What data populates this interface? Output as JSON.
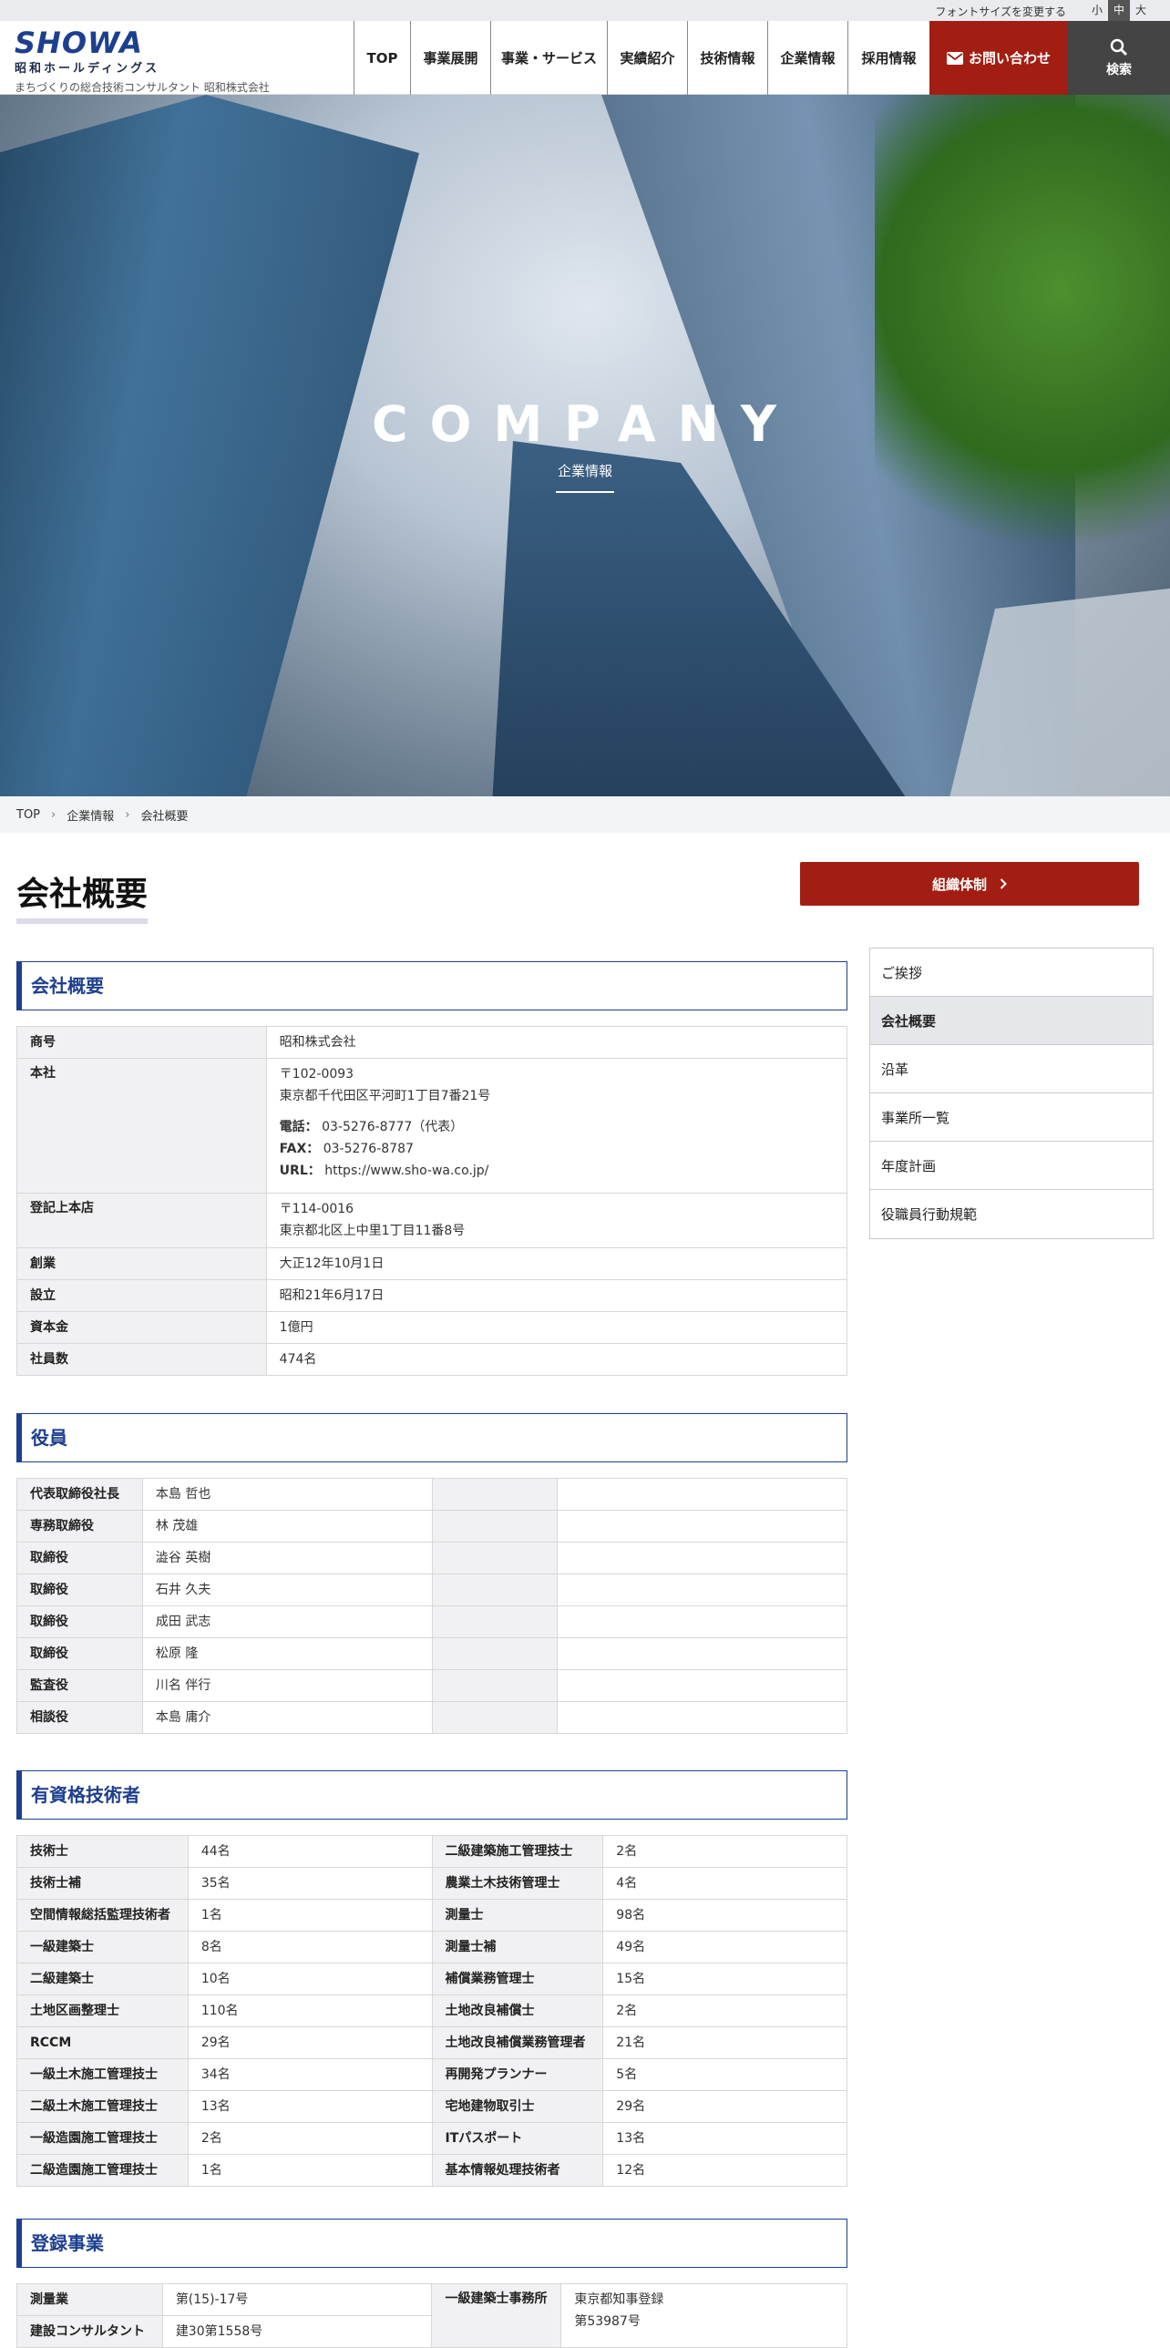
{
  "util": {
    "font_size_label": "フォントサイズを変更する",
    "sizes": [
      "小",
      "中",
      "大"
    ],
    "active": "中"
  },
  "header": {
    "logo_mark": "SHOWA",
    "logo_kana": "昭和ホールディングス",
    "tagline": "まちづくりの総合技術コンサルタント 昭和株式会社",
    "nav": [
      "TOP",
      "事業展開",
      "事業・サービス",
      "実績紹介",
      "技術情報",
      "企業情報",
      "採用情報"
    ],
    "contact": "お問い合わせ",
    "search": "検索"
  },
  "hero": {
    "title": "COMPANY",
    "subtitle": "企業情報"
  },
  "breadcrumb": [
    "TOP",
    "企業情報",
    "会社概要"
  ],
  "page_title": "会社概要",
  "org_button": "組織体制",
  "sections": {
    "overview": "会社概要",
    "officers": "役員",
    "engineers": "有資格技術者",
    "registration": "登録事業"
  },
  "overview": {
    "rows": [
      {
        "label": "商号",
        "value": "昭和株式会社"
      },
      {
        "label": "本社"
      },
      {
        "label": "登記上本店"
      },
      {
        "label": "創業",
        "value": "大正12年10月1日"
      },
      {
        "label": "設立",
        "value": "昭和21年6月17日"
      },
      {
        "label": "資本金",
        "value": "1億円"
      },
      {
        "label": "社員数",
        "value": "474名"
      }
    ],
    "hq": {
      "zip": "〒102-0093",
      "address": "東京都千代田区平河町1丁目7番21号",
      "tel_label": "電話：",
      "tel": "03-5276-8777（代表）",
      "fax_label": "FAX：",
      "fax": "03-5276-8787",
      "url_label": "URL：",
      "url": "https://www.sho-wa.co.jp/"
    },
    "registered": {
      "zip": "〒114-0016",
      "address": "東京都北区上中里1丁目11番8号"
    }
  },
  "officers": [
    {
      "role": "代表取締役社長",
      "name": "本島 哲也"
    },
    {
      "role": "専務取締役",
      "name": "林 茂雄"
    },
    {
      "role": "取締役",
      "name": "澁谷 英樹"
    },
    {
      "role": "取締役",
      "name": "石井 久夫"
    },
    {
      "role": "取締役",
      "name": "成田 武志"
    },
    {
      "role": "取締役",
      "name": "松原 隆"
    },
    {
      "role": "監査役",
      "name": "川名 伴行"
    },
    {
      "role": "相談役",
      "name": "本島 庸介"
    }
  ],
  "engineers": [
    [
      "技術士",
      "44名",
      "二級建築施工管理技士",
      "2名"
    ],
    [
      "技術士補",
      "35名",
      "農業土木技術管理士",
      "4名"
    ],
    [
      "空間情報総括監理技術者",
      "1名",
      "測量士",
      "98名"
    ],
    [
      "一級建築士",
      "8名",
      "測量士補",
      "49名"
    ],
    [
      "二級建築士",
      "10名",
      "補償業務管理士",
      "15名"
    ],
    [
      "土地区画整理士",
      "110名",
      "土地改良補償士",
      "2名"
    ],
    [
      "RCCM",
      "29名",
      "土地改良補償業務管理者",
      "21名"
    ],
    [
      "一級土木施工管理技士",
      "34名",
      "再開発プランナー",
      "5名"
    ],
    [
      "二級土木施工管理技士",
      "13名",
      "宅地建物取引士",
      "29名"
    ],
    [
      "一級造園施工管理技士",
      "2名",
      "ITパスポート",
      "13名"
    ],
    [
      "二級造園施工管理技士",
      "1名",
      "基本情報処理技術者",
      "12名"
    ]
  ],
  "registration": {
    "rows": [
      {
        "label": "測量業",
        "value": "第(15)-17号"
      },
      {
        "label": "建設コンサルタント",
        "value": "建30第1558号"
      }
    ],
    "architect_label": "一級建築士事務所",
    "architect_line1": "東京都知事登録",
    "architect_line2": "第53987号"
  },
  "sidebar": [
    "ご挨拶",
    "会社概要",
    "沿革",
    "事業所一覧",
    "年度計画",
    "役職員行動規範"
  ],
  "sidebar_active": "会社概要"
}
